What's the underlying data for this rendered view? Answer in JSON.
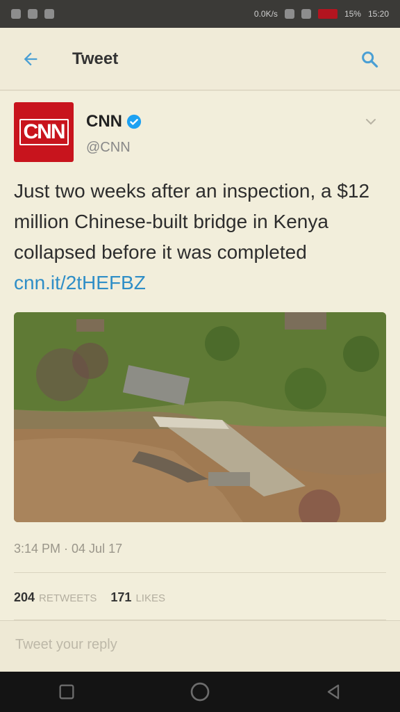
{
  "status_bar": {
    "network_speed": "0.0K/s",
    "battery_percent": "15%",
    "time": "15:20",
    "icons": [
      "notification-icon",
      "whatsapp-icon",
      "message-icon",
      "clock-icon",
      "signal-icon",
      "battery-icon"
    ]
  },
  "app_bar": {
    "title": "Tweet",
    "back_icon": "back-arrow-icon",
    "search_icon": "search-icon"
  },
  "tweet": {
    "author": {
      "display_name": "CNN",
      "handle": "@CNN",
      "avatar_text": "CNN",
      "verified": true
    },
    "text": "Just two weeks after an inspection, a $12 million Chinese-built bridge in Kenya collapsed before it was completed",
    "link": "cnn.it/2tHEFBZ",
    "timestamp": "3:14 PM · 04 Jul 17",
    "retweets": "204",
    "retweets_label": "RETWEETS",
    "likes": "171",
    "likes_label": "LIKES"
  },
  "reply": {
    "placeholder": "Tweet your reply"
  },
  "colors": {
    "accent": "#2e8ec7",
    "cnn_red": "#c8141d",
    "verified": "#1da1f2",
    "background": "#f2eedb"
  }
}
